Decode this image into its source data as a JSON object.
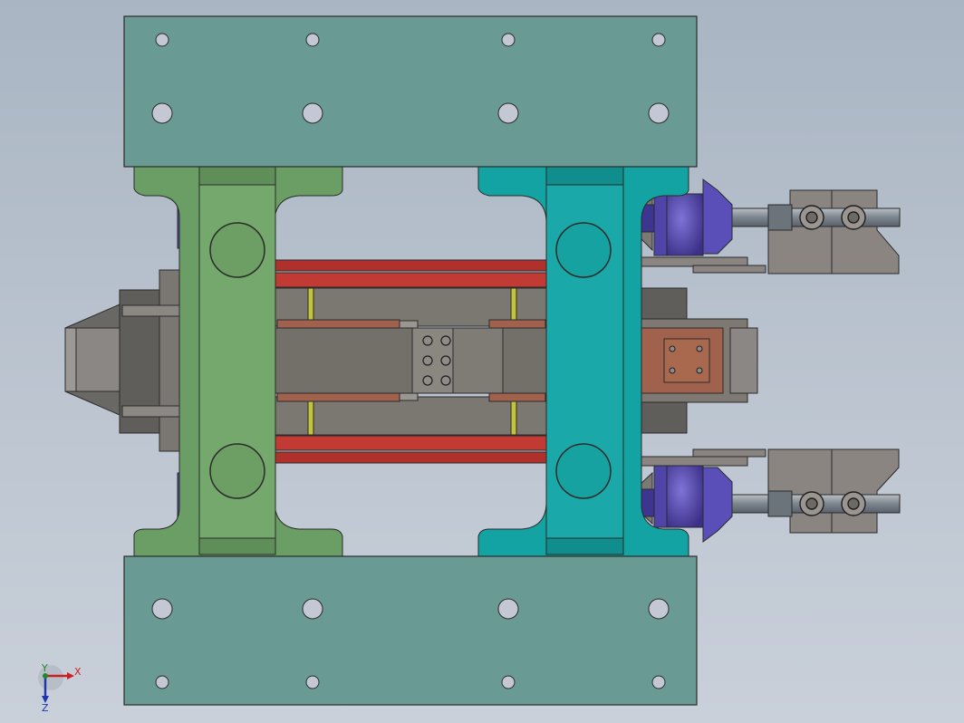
{
  "viewport": {
    "view": "top",
    "background_top": "#a9b5c3",
    "background_bottom": "#c9d0da"
  },
  "colors": {
    "plate": "#6a9a94",
    "green_frame": "#6a9e64",
    "teal_frame": "#13a3a2",
    "red_rail": "#b0302c",
    "copper": "#a0624d",
    "steel": "#6e6c68",
    "bracket": "#8a8580",
    "purple_motor": "#4a3d9a",
    "rod": "#8a939b"
  },
  "axis_triad": {
    "x_label": "X",
    "y_label": "Y",
    "z_label": "Z",
    "x_color": "#cc2020",
    "y_color": "#1f8a2a",
    "z_color": "#2035b0"
  }
}
